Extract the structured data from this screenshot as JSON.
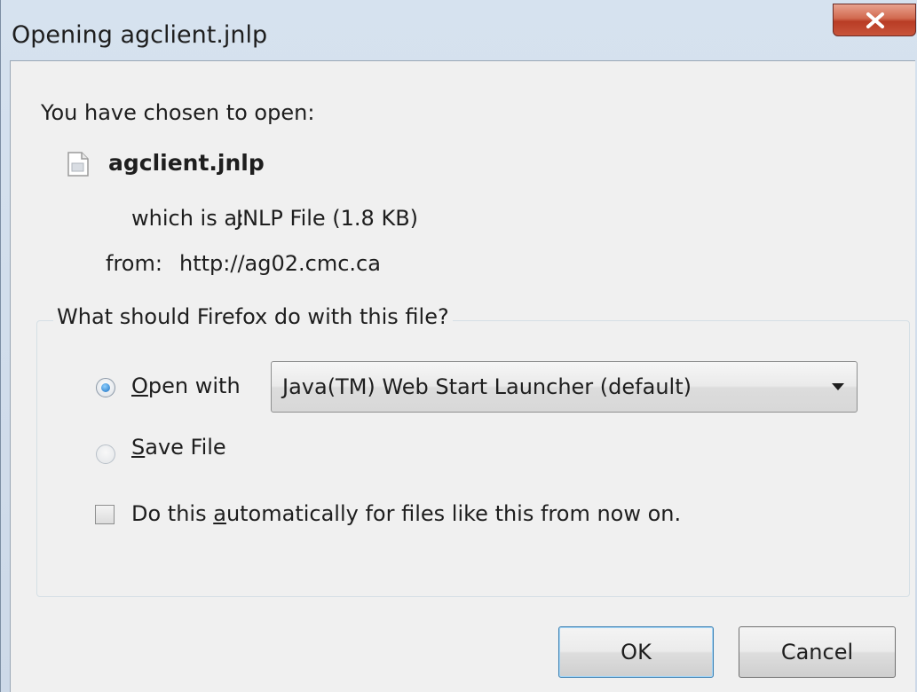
{
  "window": {
    "title": "Opening agclient.jnlp"
  },
  "intro": "You have chosen to open:",
  "file": {
    "name": "agclient.jnlp",
    "type_label": "which is a:",
    "type_value": "JNLP File (1.8 KB)",
    "from_label": "from:",
    "from_value": "http://ag02.cmc.ca",
    "icon": "document-icon"
  },
  "action_group": {
    "legend": "What should Firefox do with this file?",
    "open_with": {
      "mnemonic": "O",
      "label_rest": "pen with",
      "selected": true
    },
    "application_select": {
      "value": "Java(TM) Web Start Launcher (default)"
    },
    "save_file": {
      "mnemonic": "S",
      "label_rest": "ave File",
      "selected": false
    },
    "auto": {
      "label_before": "Do this ",
      "mnemonic": "a",
      "label_after": "utomatically for files like this from now on.",
      "checked": false
    }
  },
  "buttons": {
    "ok": "OK",
    "cancel": "Cancel"
  }
}
